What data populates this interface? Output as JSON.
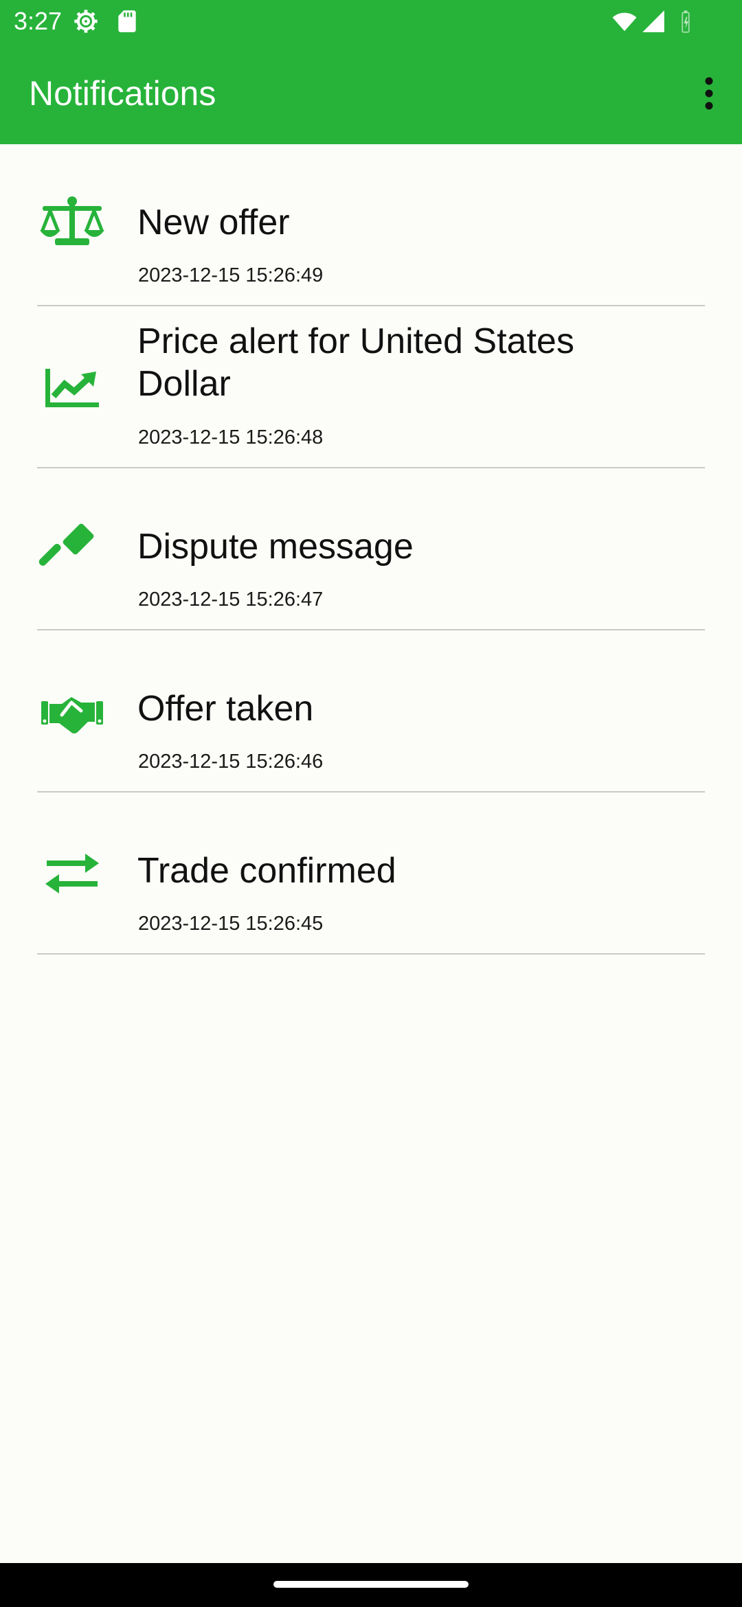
{
  "status_bar": {
    "time": "3:27",
    "icons": [
      "settings-gear-icon",
      "sd-card-icon",
      "wifi-icon",
      "cell-signal-icon",
      "battery-icon"
    ]
  },
  "app_bar": {
    "title": "Notifications",
    "overflow_icon": "more-vert-icon"
  },
  "theme": {
    "primary": "#27b33a",
    "icon": "#27b33a",
    "background": "#fcfcf8",
    "divider": "#c9c9c6"
  },
  "notifications": [
    {
      "icon": "scale-icon",
      "title": "New offer",
      "time": "2023-12-15 15:26:49"
    },
    {
      "icon": "chart-line-icon",
      "title": "Price alert for United States Dollar",
      "time": "2023-12-15 15:26:48"
    },
    {
      "icon": "gavel-icon",
      "title": "Dispute message",
      "time": "2023-12-15 15:26:47"
    },
    {
      "icon": "handshake-icon",
      "title": "Offer taken",
      "time": "2023-12-15 15:26:46"
    },
    {
      "icon": "exchange-arrows-icon",
      "title": "Trade confirmed",
      "time": "2023-12-15 15:26:45"
    }
  ]
}
